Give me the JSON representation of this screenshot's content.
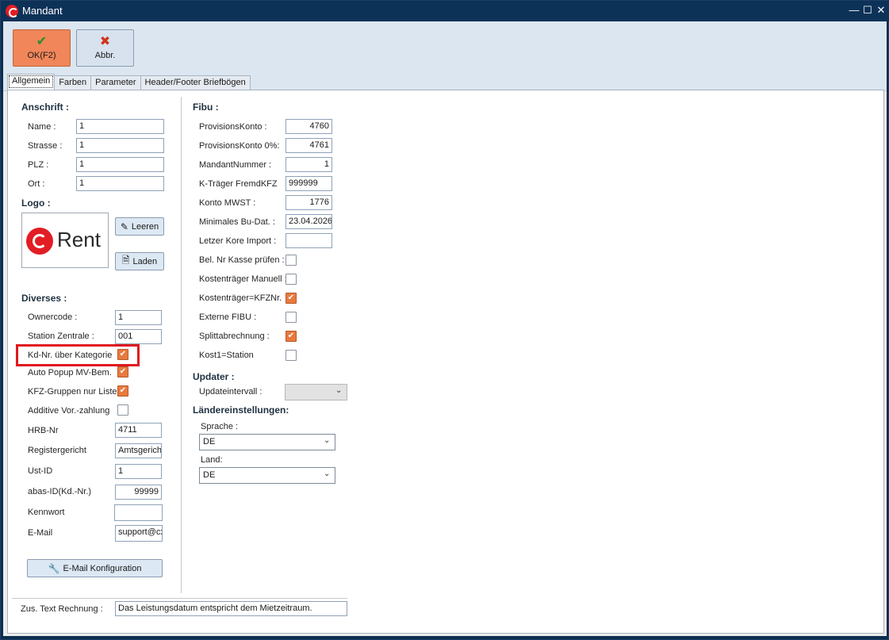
{
  "window": {
    "title": "Mandant"
  },
  "toolbar": {
    "ok_label": "OK(F2)",
    "abbr_label": "Abbr."
  },
  "tabs": [
    "Allgemein",
    "Farben",
    "Parameter",
    "Header/Footer Briefbögen"
  ],
  "anschrift": {
    "heading": "Anschrift :",
    "fields": [
      {
        "label": "Name :",
        "value": "1"
      },
      {
        "label": "Strasse :",
        "value": "1"
      },
      {
        "label": "PLZ :",
        "value": "1"
      },
      {
        "label": "Ort :",
        "value": "1"
      }
    ]
  },
  "logo": {
    "heading": "Logo :",
    "brand_text": "Rent",
    "clear_label": "Leeren",
    "load_label": "Laden"
  },
  "diverses": {
    "heading": "Diverses :",
    "ownercode": {
      "label": "Ownercode :",
      "value": "1"
    },
    "station": {
      "label": "Station Zentrale :",
      "value": "001"
    },
    "checks": [
      {
        "label": "Kd-Nr. über Kategorie",
        "checked": true
      },
      {
        "label": "Auto Popup MV-Bem.",
        "checked": true
      },
      {
        "label": "KFZ-Gruppen nur Liste",
        "checked": true
      },
      {
        "label": "Additive Vor.-zahlung",
        "checked": false
      }
    ],
    "hrb": {
      "label": "HRB-Nr",
      "value": "4711"
    },
    "registergericht": {
      "label": "Registergericht",
      "value": "Amtsgericht"
    },
    "ustid": {
      "label": "Ust-ID",
      "value": "1"
    },
    "abas": {
      "label": "abas-ID(Kd.-Nr.)",
      "value": "99999"
    },
    "kennwort": {
      "label": "Kennwort",
      "value": ""
    },
    "email": {
      "label": "E-Mail",
      "value": "support@cx"
    },
    "email_config_label": "E-Mail Konfiguration"
  },
  "fibu": {
    "heading": "Fibu :",
    "fields": [
      {
        "label": "ProvisionsKonto :",
        "value": "4760"
      },
      {
        "label": "ProvisionsKonto 0%:",
        "value": "4761"
      },
      {
        "label": "MandantNummer :",
        "value": "1"
      },
      {
        "label": "K-Träger FremdKFZ",
        "value": "999999"
      },
      {
        "label": "Konto MWST :",
        "value": "1776"
      },
      {
        "label": "Minimales Bu-Dat. :",
        "value": "23.04.2026"
      },
      {
        "label": "Letzer Kore Import :",
        "value": ""
      }
    ],
    "checks": [
      {
        "label": "Bel. Nr Kasse prüfen :",
        "checked": false
      },
      {
        "label": "Kostenträger Manuell :",
        "checked": false
      },
      {
        "label": "Kostenträger=KFZNr.",
        "checked": true
      },
      {
        "label": "Externe FIBU :",
        "checked": false
      },
      {
        "label": "Splittabrechnung :",
        "checked": true
      },
      {
        "label": "Kost1=Station",
        "checked": false
      }
    ]
  },
  "updater": {
    "heading": "Updater :",
    "interval_label": "Updateintervall :",
    "interval_value": ""
  },
  "laender": {
    "heading": "Ländereinstellungen:",
    "sprache_label": "Sprache :",
    "sprache_value": "DE",
    "land_label": "Land:",
    "land_value": "DE"
  },
  "footer": {
    "label": "Zus. Text Rechnung :",
    "value": "Das Leistungsdatum entspricht dem Mietzeitraum."
  },
  "colors": {
    "accent": "#e87a3f",
    "ok_button": "#f08659",
    "highlight": "#e0171f"
  }
}
